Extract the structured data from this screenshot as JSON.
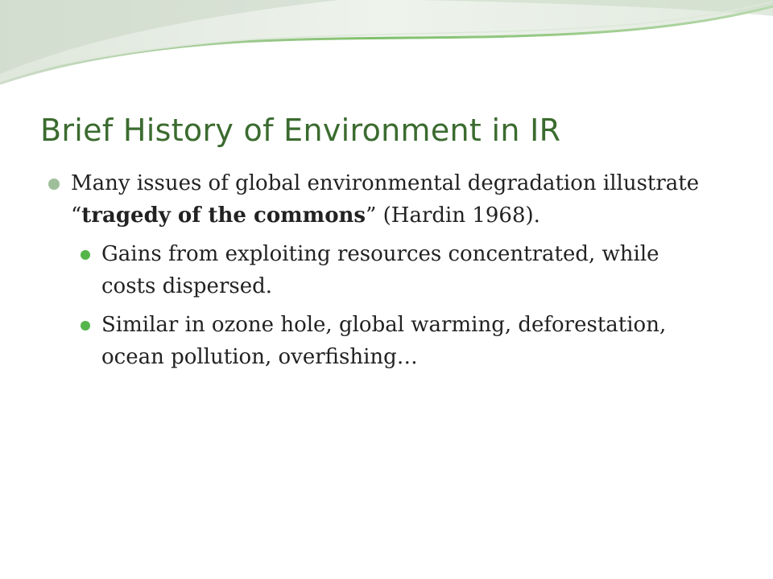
{
  "slide": {
    "title": "Brief History of Environment in IR",
    "bullet1": {
      "text_before": "Many issues of global environmental degradation illustrate “",
      "emphasis": "tragedy of the commons",
      "text_after": "” (Hardin 1968)."
    },
    "sub_bullets": [
      "Gains from exploiting resources concentrated, while costs dispersed.",
      "Similar in ozone hole, global warming, deforestation, ocean pollution, overfishing…"
    ]
  },
  "colors": {
    "title": "#3b6b2f",
    "bullet_level1": "#9fbf9a",
    "bullet_level2": "#55b54a",
    "header_band": "#e9efe6"
  }
}
